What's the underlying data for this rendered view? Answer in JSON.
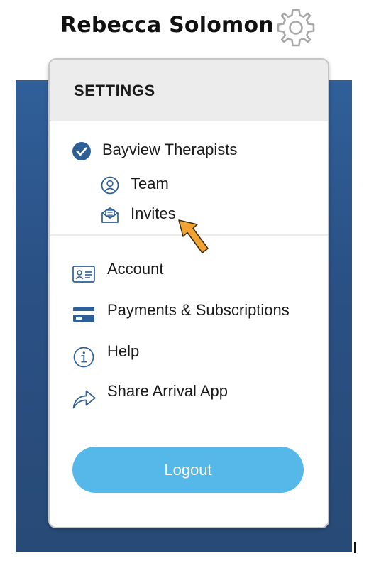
{
  "header": {
    "user_name": "Rebecca Solomon",
    "settings_icon": "gear-icon"
  },
  "menu": {
    "title": "SETTINGS",
    "organization": {
      "label": "Bayview Therapists",
      "icon": "check-circle-icon",
      "selected": true
    },
    "organization_items": [
      {
        "label": "Team",
        "icon": "person-circle-icon"
      },
      {
        "label": "Invites",
        "icon": "envelope-icon"
      }
    ],
    "items": [
      {
        "label": "Account",
        "icon": "id-card-icon"
      },
      {
        "label": "Payments & Subscriptions",
        "icon": "credit-card-icon"
      },
      {
        "label": "Help",
        "icon": "info-icon"
      },
      {
        "label": "Share Arrival App",
        "icon": "share-arrow-icon"
      }
    ],
    "logout_label": "Logout"
  },
  "colors": {
    "brand_blue": "#2a5084",
    "icon_blue": "#2f5f97",
    "logout_button": "#55b8e8",
    "annotation_arrow": "#f0a232"
  }
}
